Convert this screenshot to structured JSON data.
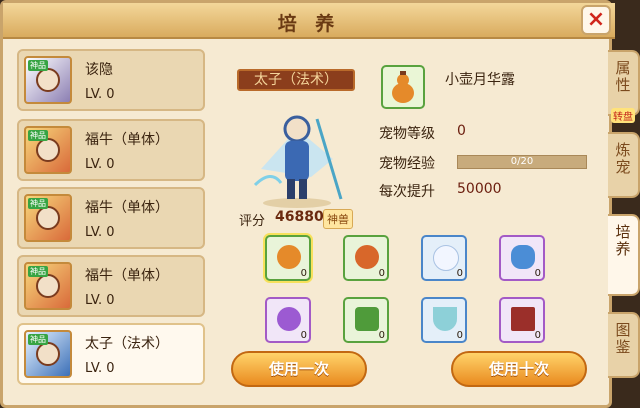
{
  "window": {
    "title": "培 养",
    "close_icon": "×"
  },
  "side_tabs": [
    {
      "label": "属性",
      "active": false
    },
    {
      "label": "炼宠",
      "active": false
    },
    {
      "label": "培养",
      "active": true
    },
    {
      "label": "图鉴",
      "active": false
    }
  ],
  "side_badge": "转盘",
  "pets": [
    {
      "name": "该隐",
      "level": "LV. 0",
      "tag": "神品"
    },
    {
      "name": "福牛（单体）",
      "level": "LV. 0",
      "tag": "神品"
    },
    {
      "name": "福牛（单体）",
      "level": "LV. 0",
      "tag": "神品"
    },
    {
      "name": "福牛（单体）",
      "level": "LV. 0",
      "tag": "神品"
    },
    {
      "name": "太子（法术）",
      "level": "LV. 0",
      "tag": "神品"
    }
  ],
  "detail": {
    "pet_name": "太子（法术）",
    "score_label": "评分",
    "score": "46880",
    "score_badge": "神兽",
    "selected_item_name": "小壶月华露",
    "stats": {
      "level_label": "宠物等级",
      "level": "0",
      "exp_label": "宠物经验",
      "exp_text": "0/20",
      "exp_progress": 0,
      "boost_label": "每次提升",
      "boost": "50000"
    }
  },
  "inventory": [
    {
      "icon": "gourd-icon",
      "count": "0",
      "rarity": "green",
      "selected": true
    },
    {
      "icon": "gourd-icon",
      "count": "0",
      "rarity": "green",
      "selected": false
    },
    {
      "icon": "pearl-icon",
      "count": "0",
      "rarity": "blue",
      "selected": false
    },
    {
      "icon": "teapot-icon",
      "count": "0",
      "rarity": "purple",
      "selected": false
    },
    {
      "icon": "orb-icon",
      "count": "0",
      "rarity": "purple",
      "selected": false
    },
    {
      "icon": "dumpling-icon",
      "count": "0",
      "rarity": "green",
      "selected": false
    },
    {
      "icon": "bowl-icon",
      "count": "0",
      "rarity": "blue",
      "selected": false
    },
    {
      "icon": "book-icon",
      "count": "0",
      "rarity": "purple",
      "selected": false
    }
  ],
  "buttons": {
    "use_once": "使用一次",
    "use_ten": "使用十次"
  },
  "colors": {
    "green": "#59a23e",
    "blue": "#4a86c9",
    "purple": "#a35ac6",
    "accent": "#e98a1f"
  }
}
